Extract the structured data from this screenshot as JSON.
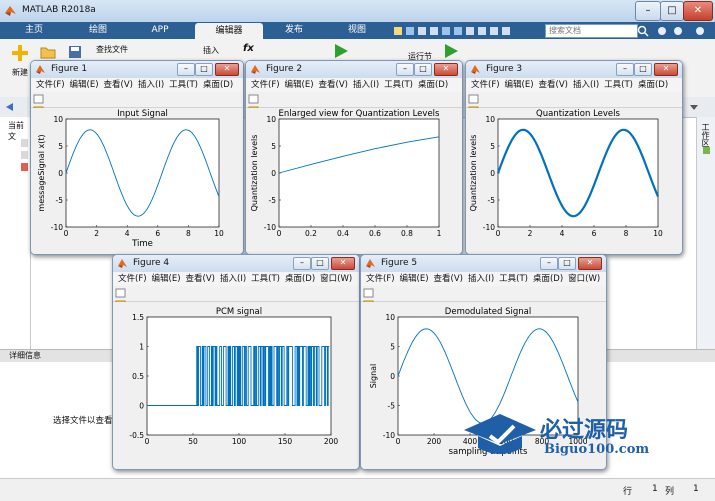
{
  "window": {
    "title": "MATLAB R2018a"
  },
  "tabs": [
    {
      "label": "主页"
    },
    {
      "label": "绘图"
    },
    {
      "label": "APP"
    },
    {
      "label": "编辑器",
      "active": true
    },
    {
      "label": "发布"
    },
    {
      "label": "视图"
    }
  ],
  "search": {
    "placeholder": "搜索文档"
  },
  "ribbon": {
    "new_label": "新建",
    "find_files_label": "查找文件",
    "insert_label": "插入",
    "fx_label": "fx",
    "run_section_label": "运行节"
  },
  "left_panel": {
    "current_folder_label": "当前文"
  },
  "right_panel": {
    "workspace_label": "工作区"
  },
  "details": {
    "header": "详细信息",
    "hint": "选择文件以查看"
  },
  "status": {
    "row_label": "行",
    "row_value": "1",
    "col_label": "列",
    "col_value": "1"
  },
  "figure_menu": [
    "文件(F)",
    "编辑(E)",
    "查看(V)",
    "插入(I)",
    "工具(T)",
    "桌面(D)",
    "窗口(W)",
    "帮助(H)"
  ],
  "figures": [
    {
      "title": "Figure 1",
      "chart_data": {
        "type": "line",
        "title": "Input Signal",
        "xlabel": "Time",
        "ylabel": "messageSignal x(t)",
        "xlim": [
          0,
          10
        ],
        "ylim": [
          -10,
          10
        ],
        "xticks": [
          "0",
          "2",
          "4",
          "6",
          "8",
          "10"
        ],
        "yticks": [
          "10",
          "5",
          "0",
          "-5",
          "-10"
        ],
        "function": "8*sin(t)",
        "color": "#0072bd"
      }
    },
    {
      "title": "Figure 2",
      "chart_data": {
        "type": "line",
        "title": "Enlarged view for Quantization Levels",
        "xlabel": "",
        "ylabel": "Quantization levels",
        "xlim": [
          0,
          1
        ],
        "ylim": [
          -10,
          10
        ],
        "xticks": [
          "0",
          "0.2",
          "0.4",
          "0.6",
          "0.8",
          "1"
        ],
        "yticks": [
          "10",
          "5",
          "0",
          "-5",
          "-10"
        ],
        "x": [
          0,
          0.2,
          0.4,
          0.6,
          0.8,
          1
        ],
        "y": [
          0,
          1.6,
          3.1,
          4.5,
          5.7,
          6.7
        ],
        "color": "#0072bd"
      }
    },
    {
      "title": "Figure 3",
      "chart_data": {
        "type": "line",
        "title": "Quantization Levels",
        "xlabel": "",
        "ylabel": "Quantization levels",
        "xlim": [
          0,
          10
        ],
        "ylim": [
          -10,
          10
        ],
        "xticks": [
          "0",
          "2",
          "4",
          "6",
          "8",
          "10"
        ],
        "yticks": [
          "10",
          "5",
          "0",
          "-5",
          "-10"
        ],
        "function": "8*sin(t)",
        "color": "#0072bd",
        "thick": true
      }
    },
    {
      "title": "Figure 4",
      "chart_data": {
        "type": "bar",
        "title": "PCM signal",
        "xlabel": "",
        "ylabel": "",
        "xlim": [
          0,
          200
        ],
        "ylim": [
          -0.5,
          1.5
        ],
        "xticks": [
          "0",
          "50",
          "100",
          "150",
          "200"
        ],
        "yticks": [
          "1.5",
          "1",
          "0.5",
          "0",
          "-0.5"
        ],
        "bits": "000000000000000000000000000000000000000000000000000000101100101100110010110100011001110010100110110101001101001110001010011011010111010100111010110110001011110001101011101110010101101101100011101101",
        "color": "#0072bd"
      }
    },
    {
      "title": "Figure 5",
      "chart_data": {
        "type": "line",
        "title": "Demodulated Signal",
        "xlabel": "sampling at points",
        "ylabel": "Signal",
        "xlim": [
          0,
          1000
        ],
        "ylim": [
          -10,
          10
        ],
        "xticks": [
          "0",
          "200",
          "400",
          "600",
          "800",
          "1000"
        ],
        "yticks": [
          "10",
          "5",
          "0",
          "-5",
          "-10"
        ],
        "function": "8*sin(2*pi*x/628)",
        "color": "#0072bd"
      }
    }
  ],
  "watermark": {
    "cn": "必过源码",
    "url": "Biguo100.com"
  }
}
